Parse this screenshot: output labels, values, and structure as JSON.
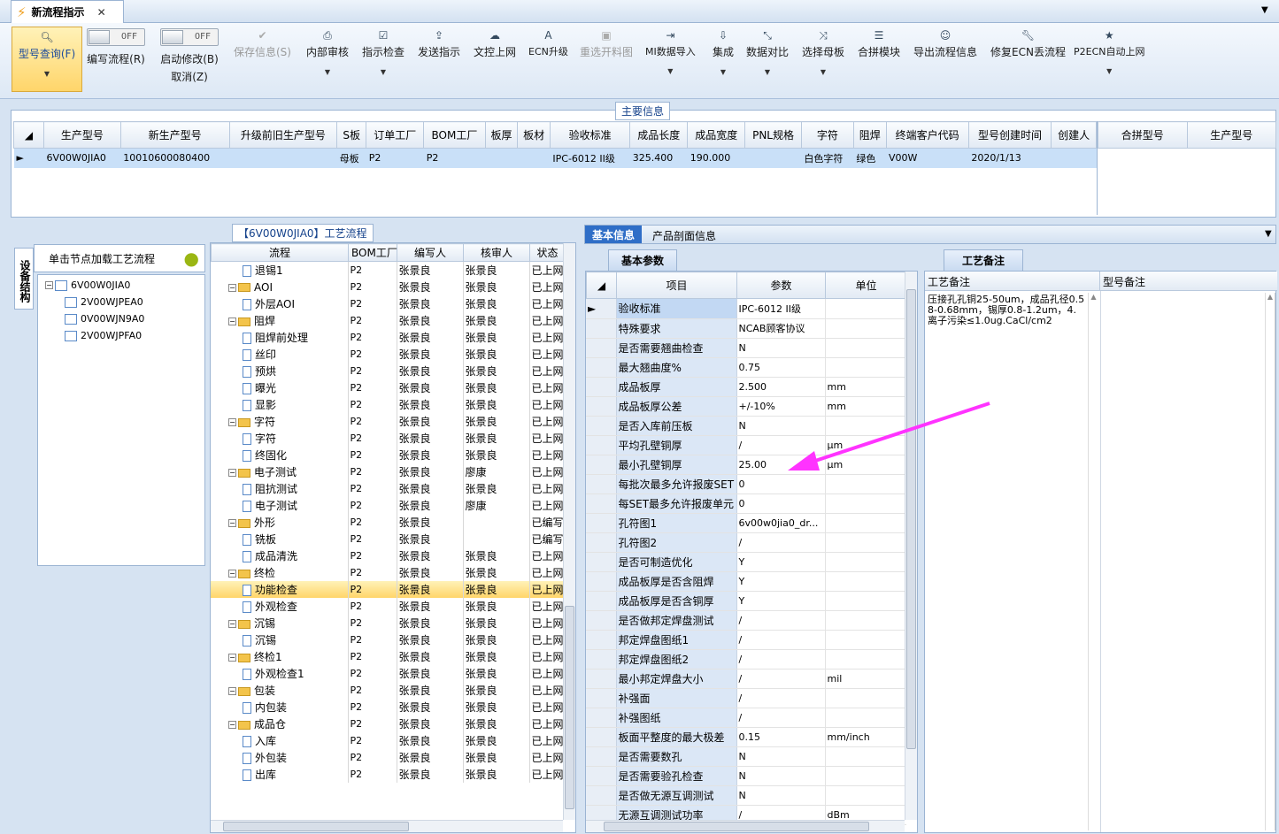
{
  "window": {
    "tab_title": "新流程指示"
  },
  "toolbar": {
    "query": "型号查询(F)",
    "edit_flow": "编写流程(R)",
    "edit_toggle": "OFF",
    "start_modify": "启动修改(B)",
    "start_toggle": "OFF",
    "cancel": "取消(Z)",
    "save": "保存信息(S)",
    "internal_review": "内部审核",
    "check": "指示检查",
    "send": "发送指示",
    "doc_upload": "文控上网",
    "ecn_upgrade": "ECN升级",
    "reselect": "重选开料图",
    "mi_import": "MI数据导入",
    "integrate": "集成",
    "compare": "数据对比",
    "choose_master": "选择母板",
    "merge": "合拼模块",
    "export": "导出流程信息",
    "fix_ecn": "修复ECN丢流程",
    "p2ecn": "P2ECN自动上网"
  },
  "main_info": {
    "group_title": "主要信息",
    "columns": [
      "生产型号",
      "新生产型号",
      "升级前旧生产型号",
      "S板",
      "订单工厂",
      "BOM工厂",
      "板厚",
      "板材",
      "验收标准",
      "成品长度",
      "成品宽度",
      "PNL规格",
      "字符",
      "阻焊",
      "终端客户代码",
      "型号创建时间",
      "创建人"
    ],
    "row": [
      "6V00W0JIA0",
      "10010600080400",
      "",
      "母板",
      "P2",
      "P2",
      "",
      "",
      "IPC-6012 II级",
      "325.400",
      "190.000",
      "",
      "白色字符",
      "绿色",
      "V00W",
      "2020/1/13",
      ""
    ],
    "side_columns": [
      "合拼型号",
      "生产型号"
    ]
  },
  "left_panel": {
    "vertical_tab": "设备结构",
    "hint": "单击节点加载工艺流程",
    "tree_root": "6V00W0JIA0",
    "tree_children": [
      "2V00WJPEA0",
      "0V00WJN9A0",
      "2V00WJPFA0"
    ]
  },
  "flow": {
    "title": "【6V00W0JIA0】工艺流程",
    "columns": [
      "流程",
      "BOM工厂",
      "编写人",
      "核审人",
      "状态"
    ],
    "rows": [
      {
        "lvl": 1,
        "name": "退锡1",
        "bom": "P2",
        "writer": "张景良",
        "checker": "张景良",
        "status": "已上网"
      },
      {
        "lvl": 0,
        "name": "AOI",
        "bom": "P2",
        "writer": "张景良",
        "checker": "张景良",
        "status": "已上网"
      },
      {
        "lvl": 1,
        "name": "外层AOI",
        "bom": "P2",
        "writer": "张景良",
        "checker": "张景良",
        "status": "已上网"
      },
      {
        "lvl": 0,
        "name": "阻焊",
        "bom": "P2",
        "writer": "张景良",
        "checker": "张景良",
        "status": "已上网"
      },
      {
        "lvl": 1,
        "name": "阻焊前处理",
        "bom": "P2",
        "writer": "张景良",
        "checker": "张景良",
        "status": "已上网"
      },
      {
        "lvl": 1,
        "name": "丝印",
        "bom": "P2",
        "writer": "张景良",
        "checker": "张景良",
        "status": "已上网"
      },
      {
        "lvl": 1,
        "name": "预烘",
        "bom": "P2",
        "writer": "张景良",
        "checker": "张景良",
        "status": "已上网"
      },
      {
        "lvl": 1,
        "name": "曝光",
        "bom": "P2",
        "writer": "张景良",
        "checker": "张景良",
        "status": "已上网"
      },
      {
        "lvl": 1,
        "name": "显影",
        "bom": "P2",
        "writer": "张景良",
        "checker": "张景良",
        "status": "已上网"
      },
      {
        "lvl": 0,
        "name": "字符",
        "bom": "P2",
        "writer": "张景良",
        "checker": "张景良",
        "status": "已上网"
      },
      {
        "lvl": 1,
        "name": "字符",
        "bom": "P2",
        "writer": "张景良",
        "checker": "张景良",
        "status": "已上网"
      },
      {
        "lvl": 1,
        "name": "终固化",
        "bom": "P2",
        "writer": "张景良",
        "checker": "张景良",
        "status": "已上网"
      },
      {
        "lvl": 0,
        "name": "电子测试",
        "bom": "P2",
        "writer": "张景良",
        "checker": "廖康",
        "status": "已上网"
      },
      {
        "lvl": 1,
        "name": "阻抗测试",
        "bom": "P2",
        "writer": "张景良",
        "checker": "张景良",
        "status": "已上网"
      },
      {
        "lvl": 1,
        "name": "电子测试",
        "bom": "P2",
        "writer": "张景良",
        "checker": "廖康",
        "status": "已上网"
      },
      {
        "lvl": 0,
        "name": "外形",
        "bom": "P2",
        "writer": "张景良",
        "checker": "",
        "status": "已编写"
      },
      {
        "lvl": 1,
        "name": "铣板",
        "bom": "P2",
        "writer": "张景良",
        "checker": "",
        "status": "已编写"
      },
      {
        "lvl": 1,
        "name": "成品清洗",
        "bom": "P2",
        "writer": "张景良",
        "checker": "张景良",
        "status": "已上网"
      },
      {
        "lvl": 0,
        "name": "终检",
        "bom": "P2",
        "writer": "张景良",
        "checker": "张景良",
        "status": "已上网"
      },
      {
        "lvl": 1,
        "name": "功能检查",
        "bom": "P2",
        "writer": "张景良",
        "checker": "张景良",
        "status": "已上网",
        "sel": true
      },
      {
        "lvl": 1,
        "name": "外观检查",
        "bom": "P2",
        "writer": "张景良",
        "checker": "张景良",
        "status": "已上网"
      },
      {
        "lvl": 0,
        "name": "沉锡",
        "bom": "P2",
        "writer": "张景良",
        "checker": "张景良",
        "status": "已上网"
      },
      {
        "lvl": 1,
        "name": "沉锡",
        "bom": "P2",
        "writer": "张景良",
        "checker": "张景良",
        "status": "已上网"
      },
      {
        "lvl": 0,
        "name": "终检1",
        "bom": "P2",
        "writer": "张景良",
        "checker": "张景良",
        "status": "已上网"
      },
      {
        "lvl": 1,
        "name": "外观检查1",
        "bom": "P2",
        "writer": "张景良",
        "checker": "张景良",
        "status": "已上网"
      },
      {
        "lvl": 0,
        "name": "包装",
        "bom": "P2",
        "writer": "张景良",
        "checker": "张景良",
        "status": "已上网"
      },
      {
        "lvl": 1,
        "name": "内包装",
        "bom": "P2",
        "writer": "张景良",
        "checker": "张景良",
        "status": "已上网"
      },
      {
        "lvl": 0,
        "name": "成品仓",
        "bom": "P2",
        "writer": "张景良",
        "checker": "张景良",
        "status": "已上网"
      },
      {
        "lvl": 1,
        "name": "入库",
        "bom": "P2",
        "writer": "张景良",
        "checker": "张景良",
        "status": "已上网"
      },
      {
        "lvl": 1,
        "name": "外包装",
        "bom": "P2",
        "writer": "张景良",
        "checker": "张景良",
        "status": "已上网"
      },
      {
        "lvl": 1,
        "name": "出库",
        "bom": "P2",
        "writer": "张景良",
        "checker": "张景良",
        "status": "已上网"
      }
    ]
  },
  "detail": {
    "tab_basic": "基本信息",
    "tab_profile": "产品剖面信息",
    "sub_basic": "基本参数",
    "columns": [
      "项目",
      "参数",
      "单位"
    ],
    "params": [
      [
        "验收标准",
        "IPC-6012 II级",
        ""
      ],
      [
        "特殊要求",
        "NCAB顾客协议",
        ""
      ],
      [
        "是否需要翘曲检查",
        "N",
        ""
      ],
      [
        "最大翘曲度%",
        "0.75",
        ""
      ],
      [
        "成品板厚",
        "2.500",
        "mm"
      ],
      [
        "成品板厚公差",
        "+/-10%",
        "mm"
      ],
      [
        "是否入库前压板",
        "N",
        ""
      ],
      [
        "平均孔壁铜厚",
        "/",
        "μm"
      ],
      [
        "最小孔壁铜厚",
        "25.00",
        "μm"
      ],
      [
        "每批次最多允许报废SET",
        "0",
        ""
      ],
      [
        "每SET最多允许报废单元",
        "0",
        ""
      ],
      [
        "孔符图1",
        "6v00w0jia0_dr...",
        ""
      ],
      [
        "孔符图2",
        "/",
        ""
      ],
      [
        "是否可制造优化",
        "Y",
        ""
      ],
      [
        "成品板厚是否含阻焊",
        "Y",
        ""
      ],
      [
        "成品板厚是否含铜厚",
        "Y",
        ""
      ],
      [
        "是否做邦定焊盘测试",
        "/",
        ""
      ],
      [
        "邦定焊盘图纸1",
        "/",
        ""
      ],
      [
        "邦定焊盘图纸2",
        "/",
        ""
      ],
      [
        "最小邦定焊盘大小",
        "/",
        "mil"
      ],
      [
        "补强面",
        "/",
        ""
      ],
      [
        "补强图纸",
        "/",
        ""
      ],
      [
        "板面平整度的最大极差",
        "0.15",
        "mm/inch"
      ],
      [
        "是否需要数孔",
        "N",
        ""
      ],
      [
        "是否需要验孔检查",
        "N",
        ""
      ],
      [
        "是否做无源互调测试",
        "N",
        ""
      ],
      [
        "无源互调测试功率",
        "/",
        "dBm"
      ]
    ],
    "process_tab": "工艺备注",
    "process_col": "工艺备注",
    "model_col": "型号备注",
    "process_note": "压接孔孔铜25-50um，成品孔径0.58-0.68mm，锡厚0.8-1.2um，4.    离子污染≤1.0ug.CaCl/cm2"
  },
  "colors": {
    "accent": "#ff33ff",
    "selected": "#ffd56a",
    "row": "#c9e0f8"
  }
}
